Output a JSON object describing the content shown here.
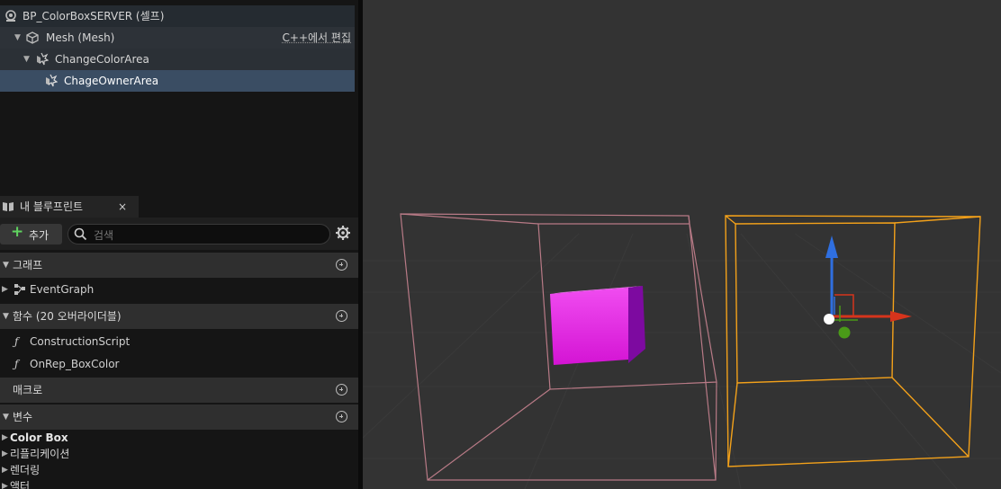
{
  "components": {
    "root": "BP_ColorBoxSERVER (셀프)",
    "mesh": "Mesh (Mesh)",
    "mesh_edit_link": "C++에서 편집",
    "change_color_area": "ChangeColorArea",
    "chage_owner_area": "ChageOwnerArea"
  },
  "my_blueprint": {
    "tab_title": "내 블루프린트",
    "close_glyph": "×",
    "add_label": "추가",
    "search_placeholder": "검색",
    "graphs": {
      "title": "그래프",
      "items": [
        "EventGraph"
      ]
    },
    "functions": {
      "title": "함수 (20 오버라이더블)",
      "items": [
        {
          "icon": "construction-script-icon",
          "label": "ConstructionScript"
        },
        {
          "icon": "function-icon",
          "label": "OnRep_BoxColor"
        }
      ]
    },
    "macros": {
      "title": "매크로"
    },
    "variables": {
      "title": "변수",
      "categories": [
        "Color Box",
        "리플리케이션",
        "렌더링",
        "액터"
      ]
    }
  },
  "colors": {
    "selected_row": "#3a4d63",
    "box_magenta": "#e020e0",
    "trigger_box_pink": "#b87a86",
    "selected_box_orange": "#f3a11a",
    "gizmo_blue": "#2f6fe0",
    "gizmo_red": "#d6341c",
    "gizmo_green": "#4a9a18"
  }
}
